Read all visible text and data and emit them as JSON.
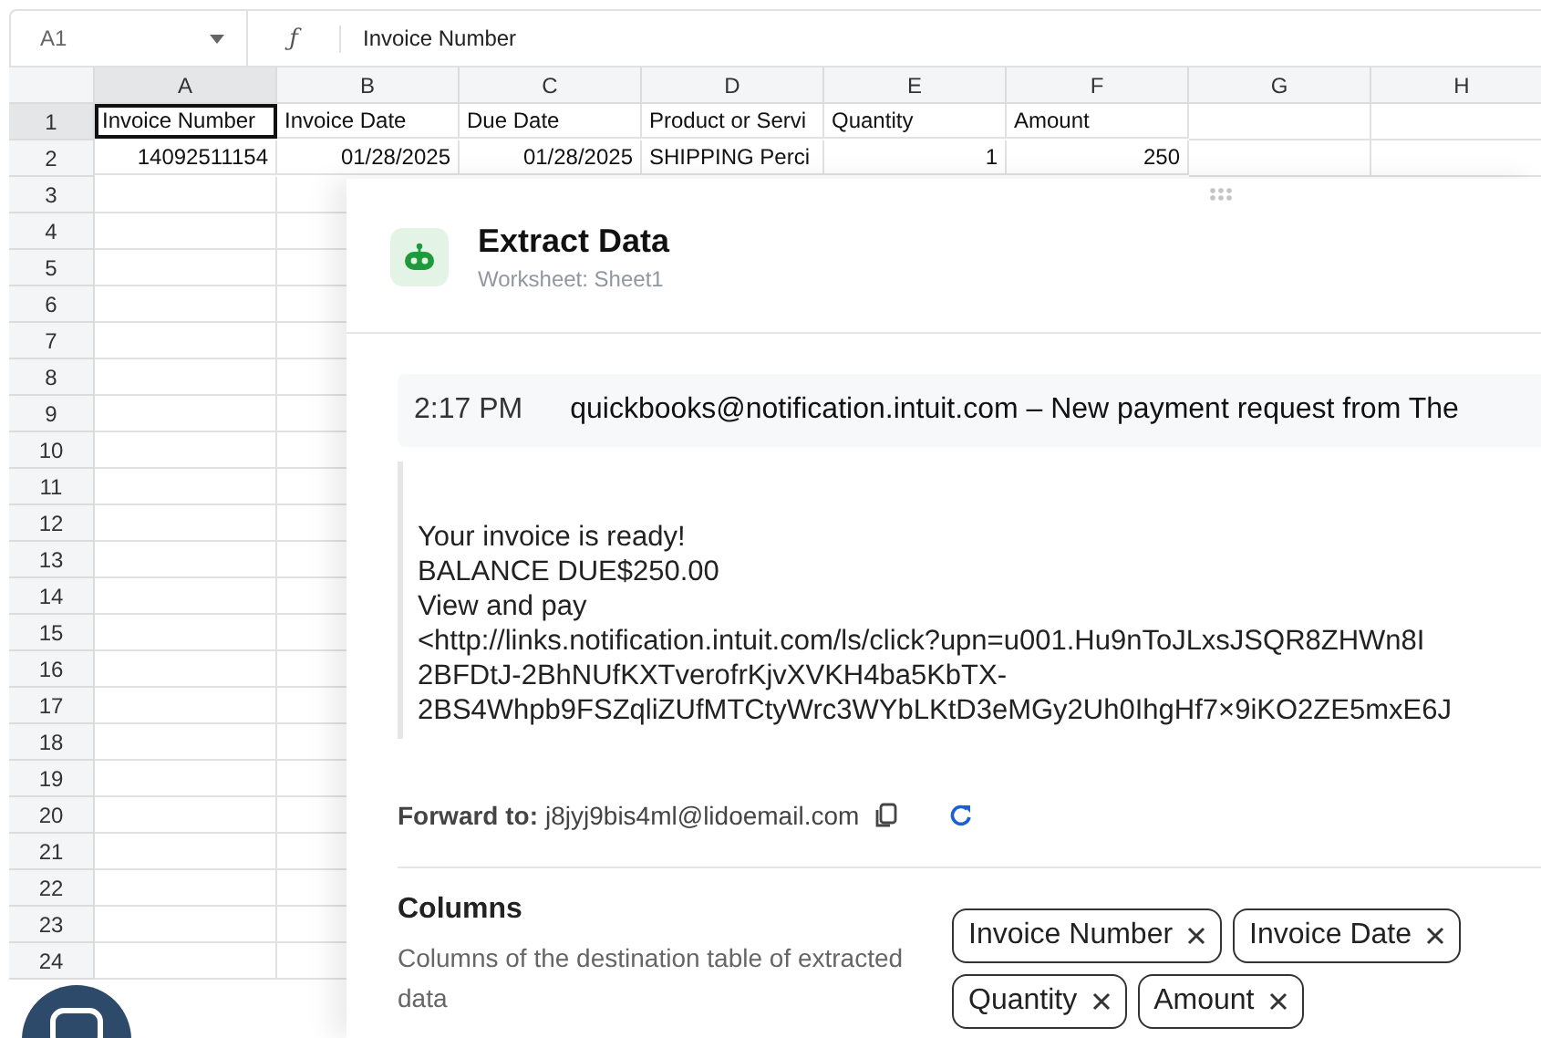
{
  "formula_bar": {
    "cell_ref": "A1",
    "fx": "ƒ",
    "value": "Invoice Number"
  },
  "sheet": {
    "columns": [
      "A",
      "B",
      "C",
      "D",
      "E",
      "F",
      "G",
      "H"
    ],
    "rows": [
      {
        "number": "1",
        "cells": [
          {
            "text": "Invoice Number",
            "kind": "text",
            "selected": true
          },
          {
            "text": "Invoice Date",
            "kind": "text",
            "selected": false
          },
          {
            "text": "Due Date",
            "kind": "text",
            "selected": false
          },
          {
            "text": "Product or Servi",
            "kind": "text",
            "selected": false
          },
          {
            "text": "Quantity",
            "kind": "text",
            "selected": false
          },
          {
            "text": "Amount",
            "kind": "text",
            "selected": false
          }
        ]
      },
      {
        "number": "2",
        "cells": [
          {
            "text": "14092511154",
            "kind": "number",
            "selected": false
          },
          {
            "text": "01/28/2025",
            "kind": "number",
            "selected": false
          },
          {
            "text": "01/28/2025",
            "kind": "number",
            "selected": false
          },
          {
            "text": "SHIPPING Perci",
            "kind": "text",
            "selected": false
          },
          {
            "text": "1",
            "kind": "number",
            "selected": false
          },
          {
            "text": "250",
            "kind": "number",
            "selected": false
          }
        ]
      },
      {
        "number": "3"
      },
      {
        "number": "4"
      },
      {
        "number": "5"
      },
      {
        "number": "6"
      },
      {
        "number": "7"
      },
      {
        "number": "8"
      },
      {
        "number": "9"
      },
      {
        "number": "10"
      },
      {
        "number": "11"
      },
      {
        "number": "12"
      },
      {
        "number": "13"
      },
      {
        "number": "14"
      },
      {
        "number": "15"
      },
      {
        "number": "16"
      },
      {
        "number": "17"
      },
      {
        "number": "18"
      },
      {
        "number": "19"
      },
      {
        "number": "20"
      },
      {
        "number": "21"
      },
      {
        "number": "22"
      },
      {
        "number": "23"
      },
      {
        "number": "24"
      }
    ]
  },
  "panel": {
    "title": "Extract Data",
    "subtitle": "Worksheet: Sheet1",
    "email": {
      "time": "2:17 PM",
      "subject": "quickbooks@notification.intuit.com – New payment request from The"
    },
    "body_lines": [
      "Your invoice is ready!",
      "BALANCE DUE$250.00",
      "View and pay",
      "<http://links.notification.intuit.com/ls/click?upn=u001.Hu9nToJLxsJSQR8ZHWn8I",
      "2BFDtJ-2BhNUfKXTverofrKjvXVKH4ba5KbTX-",
      "2BS4Whpb9FSZqliZUfMTCtyWrc3WYbLKtD3eMGy2Uh0IhgHf7×9iKO2ZE5mxE6J"
    ],
    "forward": {
      "label": "Forward to:",
      "address": "j8jyj9bis4ml@lidoemail.com"
    },
    "columns_section": {
      "title": "Columns",
      "description": "Columns of the destination table of extracted data",
      "tags": [
        "Invoice Number",
        "Invoice Date",
        "Quantity",
        "Amount"
      ]
    }
  }
}
